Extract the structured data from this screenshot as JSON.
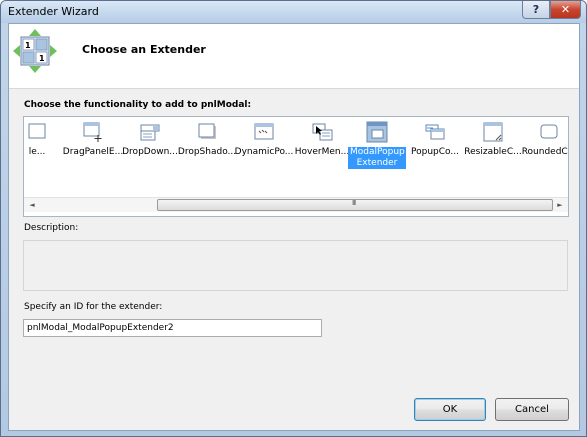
{
  "window": {
    "title": "Extender Wizard",
    "help_glyph": "?",
    "close_glyph": "✕"
  },
  "header": {
    "title": "Choose an Extender",
    "icon": "wizard-grid-icon"
  },
  "functionality_label": "Choose the functionality to add to pnlModal:",
  "extenders": [
    {
      "label": "le...",
      "icon": "partial-extender-icon"
    },
    {
      "label": "DragPanelE...",
      "icon": "drag-panel-icon"
    },
    {
      "label": "DropDown...",
      "icon": "dropdown-icon"
    },
    {
      "label": "DropShado...",
      "icon": "drop-shadow-icon"
    },
    {
      "label": "DynamicPo...",
      "icon": "dynamic-populate-icon"
    },
    {
      "label": "HoverMen...",
      "icon": "hover-menu-icon"
    },
    {
      "label": "ModalPopup Extender",
      "icon": "modal-popup-icon",
      "selected": true
    },
    {
      "label": "PopupCo...",
      "icon": "popup-control-icon"
    },
    {
      "label": "ResizableC...",
      "icon": "resizable-control-icon"
    },
    {
      "label": "RoundedC...",
      "icon": "rounded-corners-icon"
    }
  ],
  "scrollbar": {
    "left_arrow": "◄",
    "right_arrow": "►",
    "grip": "III"
  },
  "description": {
    "label": "Description:",
    "text": ""
  },
  "id_field": {
    "label": "Specify an ID for the extender:",
    "value": "pnlModal_ModalPopupExtender2"
  },
  "buttons": {
    "ok": "OK",
    "cancel": "Cancel"
  },
  "colors": {
    "selection": "#3399ff",
    "title_gradient": "#c6d9ee",
    "close_red": "#c8452f"
  }
}
